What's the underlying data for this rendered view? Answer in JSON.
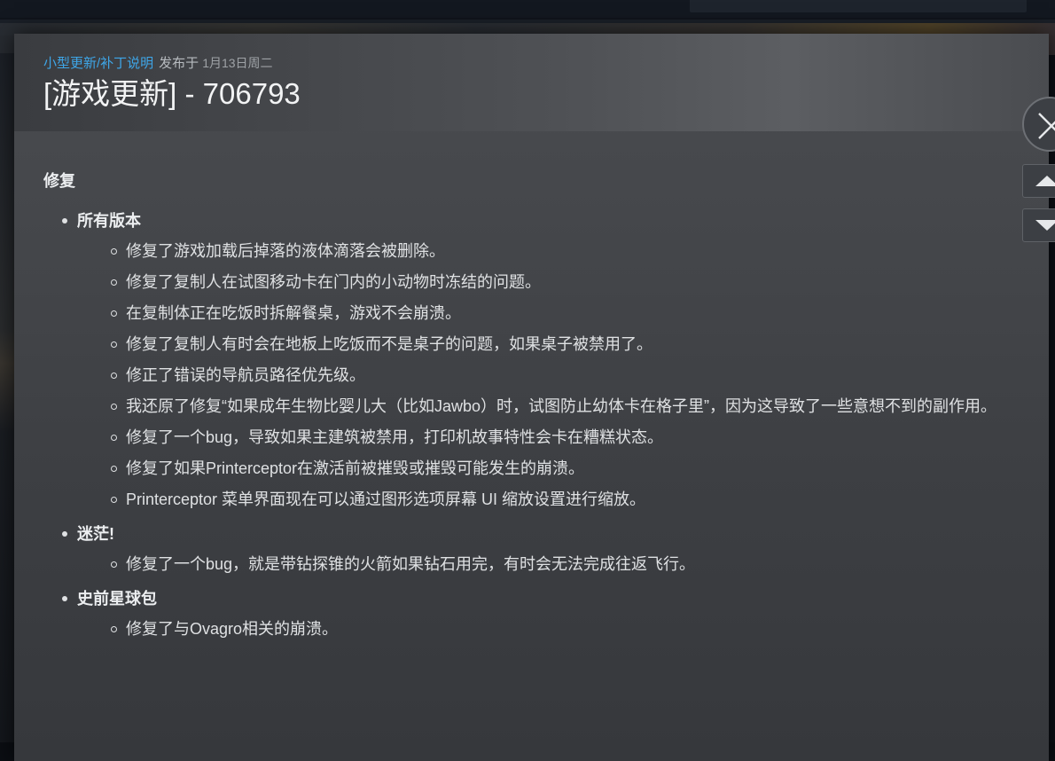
{
  "event": {
    "category": "小型更新/补丁说明",
    "posted_label": "发布于",
    "posted_date": "1月13日周二",
    "title": "[游戏更新] - 706793"
  },
  "notes": {
    "section_heading": "修复",
    "groups": [
      {
        "title": "所有版本",
        "fixes": [
          "修复了游戏加载后掉落的液体滴落会被删除。",
          "修复了复制人在试图移动卡在门内的小动物时冻结的问题。",
          "在复制体正在吃饭时拆解餐桌，游戏不会崩溃。",
          "修复了复制人有时会在地板上吃饭而不是桌子的问题，如果桌子被禁用了。",
          "修正了错误的导航员路径优先级。",
          "我还原了修复“如果成年生物比婴儿大（比如Jawbo）时，试图防止幼体卡在格子里”，因为这导致了一些意想不到的副作用。",
          "修复了一个bug，导致如果主建筑被禁用，打印机故事特性会卡在糟糕状态。",
          "修复了如果Printerceptor在激活前被摧毁或摧毁可能发生的崩溃。",
          "Printerceptor 菜单界面现在可以通过图形选项屏幕 UI 缩放设置进行缩放。"
        ]
      },
      {
        "title": "迷茫!",
        "fixes": [
          "修复了一个bug，就是带钻探锥的火箭如果钻石用完，有时会无法完成往返飞行。"
        ]
      },
      {
        "title": "史前星球包",
        "fixes": [
          "修复了与Ovagro相关的崩溃。"
        ]
      }
    ]
  },
  "controls": {
    "close_icon": "close-x-icon",
    "up_icon": "triangle-up-icon",
    "down_icon": "triangle-down-icon"
  },
  "colors": {
    "link": "#3ea6e8",
    "title": "#f2f3f4",
    "body_text": "#dfe1e3",
    "modal_bg": "#44464a"
  }
}
